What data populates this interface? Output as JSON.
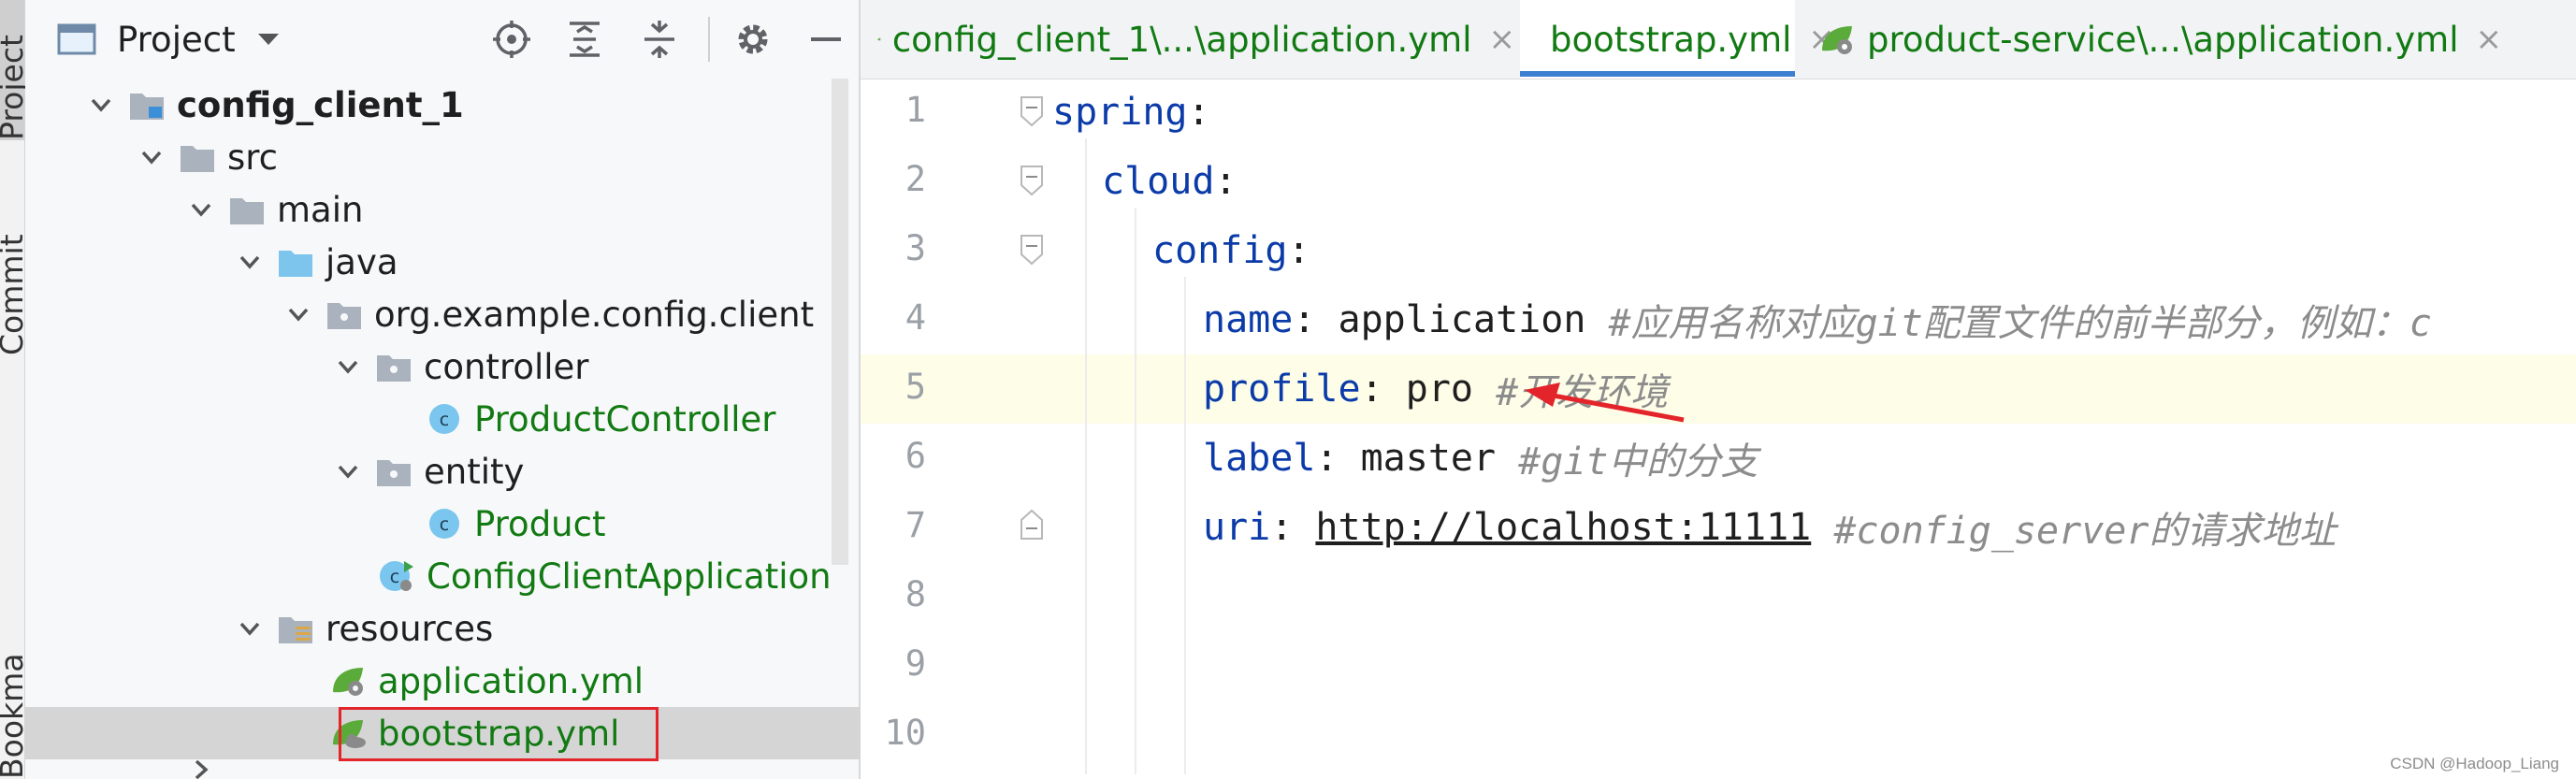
{
  "tool_strip": {
    "project_tab": "Project",
    "commit_tab": "Commit",
    "bookmarks_tab": "Bookmarks"
  },
  "project_panel": {
    "title": "Project",
    "tree": [
      {
        "label": "config_client_1",
        "icon": "module-folder-icon",
        "expanded": true
      },
      {
        "label": "src",
        "icon": "folder-icon",
        "expanded": true
      },
      {
        "label": "main",
        "icon": "folder-icon",
        "expanded": true
      },
      {
        "label": "java",
        "icon": "source-folder-icon",
        "expanded": true
      },
      {
        "label": "org.example.config.client",
        "icon": "package-icon",
        "expanded": true
      },
      {
        "label": "controller",
        "icon": "package-icon",
        "expanded": true
      },
      {
        "label": "ProductController",
        "icon": "class-icon"
      },
      {
        "label": "entity",
        "icon": "package-icon",
        "expanded": true
      },
      {
        "label": "Product",
        "icon": "class-icon"
      },
      {
        "label": "ConfigClientApplication",
        "icon": "spring-boot-class-icon"
      },
      {
        "label": "resources",
        "icon": "resources-folder-icon",
        "expanded": true
      },
      {
        "label": "application.yml",
        "icon": "spring-yml-icon"
      },
      {
        "label": "bootstrap.yml",
        "icon": "spring-bootstrap-yml-icon",
        "selected": true
      }
    ]
  },
  "editor": {
    "tabs": [
      {
        "label": "config_client_1\\...\\application.yml",
        "icon": "spring-yml-icon",
        "close": "×"
      },
      {
        "label": "bootstrap.yml",
        "icon": "spring-bootstrap-yml-icon",
        "active": true,
        "close": "×"
      },
      {
        "label": "product-service\\...\\application.yml",
        "icon": "spring-yml-icon",
        "close": "×"
      }
    ],
    "line_numbers": [
      "1",
      "2",
      "3",
      "4",
      "5",
      "6",
      "7",
      "8",
      "9",
      "10"
    ],
    "lines": {
      "l1": {
        "key": "spring",
        "colon": ":"
      },
      "l2": {
        "key": "cloud",
        "colon": ":"
      },
      "l3": {
        "key": "config",
        "colon": ":"
      },
      "l4": {
        "key": "name",
        "colon": ": ",
        "value": "application ",
        "comment": "#应用名称对应git配置文件的前半部分，例如：c"
      },
      "l5": {
        "key": "profile",
        "colon": ": ",
        "value": "pro ",
        "comment": "#开发环境"
      },
      "l6": {
        "key": "label",
        "colon": ": ",
        "value": "master ",
        "comment": "#git中的分支"
      },
      "l7": {
        "key": "uri",
        "colon": ": ",
        "value": "http://localhost:11111",
        "comment": " #config_server的请求地址"
      }
    }
  },
  "colors": {
    "selection_box": "#e3242b",
    "annotation_arrow": "#e3242b",
    "yaml_key": "#0b3ba8",
    "comment": "#8c8c8c",
    "file_green": "#127a12",
    "active_tab_underline": "#3d7fd1"
  },
  "watermark": "CSDN @Hadoop_Liang"
}
